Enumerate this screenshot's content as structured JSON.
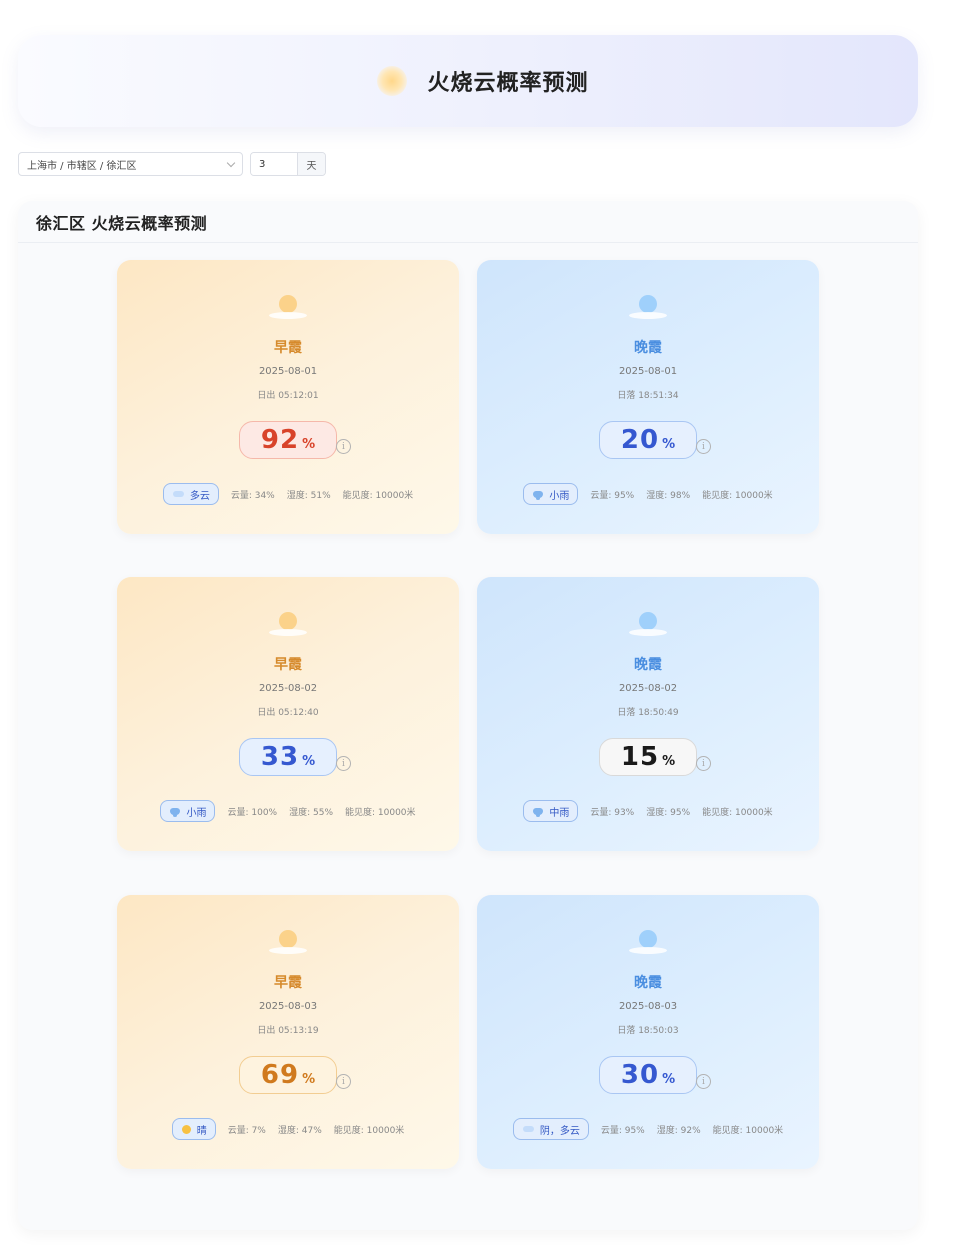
{
  "header": {
    "title": "火烧云概率预测",
    "icon": "sun-icon"
  },
  "controls": {
    "location_value": "上海市 / 市辖区 / 徐汇区",
    "days_value": "3",
    "days_unit": "天"
  },
  "panel": {
    "title": "徐汇区 火烧云概率预测"
  },
  "colors": {
    "probability_red": "#d8432a",
    "probability_blue": "#3558d0",
    "probability_black": "#1a1a1a",
    "probability_orange": "#d07a1e",
    "morning_label": "#d68a2c",
    "evening_label": "#4a8ee0"
  },
  "cards": [
    {
      "type": "早霞",
      "date": "2025-08-01",
      "suntime": "日出 05:12:01",
      "probability": "92",
      "unit": "%",
      "weather": "多云",
      "weather_icon": "cloud-icon",
      "cloud": "云量: 34%",
      "humidity": "湿度: 51%",
      "visibility": "能见度: 10000米"
    },
    {
      "type": "晚霞",
      "date": "2025-08-01",
      "suntime": "日落 18:51:34",
      "probability": "20",
      "unit": "%",
      "weather": "小雨",
      "weather_icon": "rain-icon",
      "cloud": "云量: 95%",
      "humidity": "湿度: 98%",
      "visibility": "能见度: 10000米"
    },
    {
      "type": "早霞",
      "date": "2025-08-02",
      "suntime": "日出 05:12:40",
      "probability": "33",
      "unit": "%",
      "weather": "小雨",
      "weather_icon": "rain-icon",
      "cloud": "云量: 100%",
      "humidity": "湿度: 55%",
      "visibility": "能见度: 10000米"
    },
    {
      "type": "晚霞",
      "date": "2025-08-02",
      "suntime": "日落 18:50:49",
      "probability": "15",
      "unit": "%",
      "weather": "中雨",
      "weather_icon": "rain-icon",
      "cloud": "云量: 93%",
      "humidity": "湿度: 95%",
      "visibility": "能见度: 10000米"
    },
    {
      "type": "早霞",
      "date": "2025-08-03",
      "suntime": "日出 05:13:19",
      "probability": "69",
      "unit": "%",
      "weather": "晴",
      "weather_icon": "sunny-icon",
      "cloud": "云量: 7%",
      "humidity": "湿度: 47%",
      "visibility": "能见度: 10000米"
    },
    {
      "type": "晚霞",
      "date": "2025-08-03",
      "suntime": "日落 18:50:03",
      "probability": "30",
      "unit": "%",
      "weather": "阴，多云",
      "weather_icon": "cloud-icon",
      "cloud": "云量: 95%",
      "humidity": "湿度: 92%",
      "visibility": "能见度: 10000米"
    }
  ]
}
